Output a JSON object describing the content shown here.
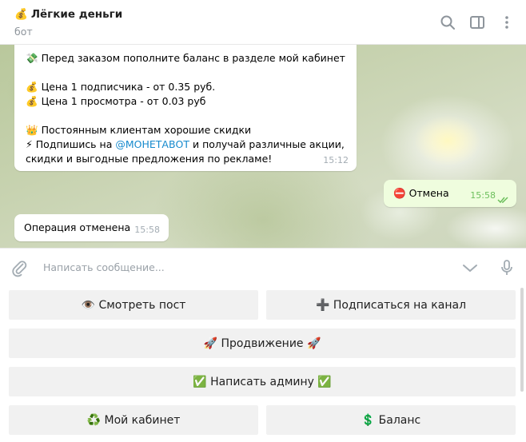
{
  "header": {
    "title_emoji": "💰",
    "title": "Лёгкие деньги",
    "subtitle": "бот",
    "icons": [
      "search-icon",
      "sidebar-toggle-icon",
      "more-vertical-icon"
    ]
  },
  "messages": {
    "first": {
      "lines": [
        {
          "emoji": "💸",
          "text": "Перед заказом пополните баланс в разделе мой кабинет"
        },
        {
          "emoji": "💰",
          "text": "Цена 1 подписчика - от 0.35 руб."
        },
        {
          "emoji": "💰",
          "text": "Цена 1 просмотра - от 0.03 руб"
        },
        {
          "emoji": "👑",
          "text": "Постоянным клиентам хорошие скидки"
        },
        {
          "emoji": "⚡",
          "text_before": "Подпишись на ",
          "link": "@МОНЕТАВОТ",
          "text_after": " и получай различные акции,"
        },
        {
          "text": "скидки и выгодные предложения по рекламе!"
        }
      ],
      "time": "15:12"
    },
    "outgoing": {
      "emoji": "⛔",
      "text": "Отмена",
      "time": "15:58"
    },
    "second": {
      "text": "Операция отменена",
      "time": "15:58"
    }
  },
  "composer": {
    "placeholder": "Написать сообщение...",
    "icons": [
      "attach-icon",
      "chevron-down-icon",
      "microphone-icon"
    ]
  },
  "keyboard": {
    "view_post": "👁️ Смотреть пост",
    "subscribe": "➕ Подписаться на канал",
    "promotion": "🚀 Продвижение 🚀",
    "write_admin": "✅ Написать админу ✅",
    "cabinet": "♻️ Мой кабинет",
    "balance": "💲 Баланс"
  },
  "colors": {
    "outgoing_bubble": "#effdde",
    "link": "#168acd",
    "keyboard_button": "#f1f1f1",
    "check_green": "#6cbf5c"
  }
}
